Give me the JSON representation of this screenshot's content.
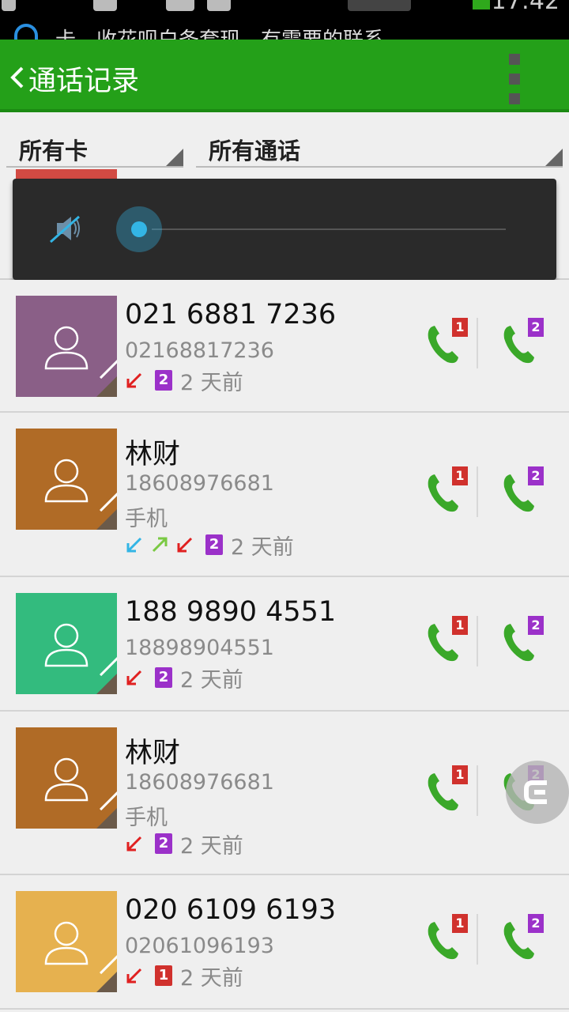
{
  "status_bar": {
    "notification": "卡，收花呗白条套现，有需要的联系",
    "time": "17:42"
  },
  "app_bar": {
    "title": "通话记录"
  },
  "filters": {
    "card": "所有卡",
    "calls": "所有通话"
  },
  "volume": {
    "level": 0
  },
  "calls": [
    {
      "name": "021 6881 7236",
      "number": "02168817236",
      "type": "",
      "directions": [
        "incoming-missed"
      ],
      "sim": "2",
      "time": "2 天前",
      "avatar_color": "#8a5f87"
    },
    {
      "name": "林财",
      "number": "18608976681",
      "type": "手机",
      "directions": [
        "incoming",
        "outgoing",
        "incoming-missed"
      ],
      "sim": "2",
      "time": "2 天前",
      "avatar_color": "#b06b26"
    },
    {
      "name": "188 9890 4551",
      "number": "18898904551",
      "type": "",
      "directions": [
        "incoming-missed"
      ],
      "sim": "2",
      "time": "2 天前",
      "avatar_color": "#33bb7e"
    },
    {
      "name": "林财",
      "number": "18608976681",
      "type": "手机",
      "directions": [
        "incoming-missed"
      ],
      "sim": "2",
      "time": "2 天前",
      "avatar_color": "#b06b26"
    },
    {
      "name": "020 6109 6193",
      "number": "02061096193",
      "type": "",
      "directions": [
        "incoming-missed"
      ],
      "sim": "1",
      "time": "2 天前",
      "avatar_color": "#e6b14f"
    }
  ],
  "call_buttons": {
    "sim1": "1",
    "sim2": "2"
  },
  "colors": {
    "accent": "#24a019",
    "sim1": "#d0312d",
    "sim2": "#9b31c9",
    "call_green": "#3aa829"
  }
}
